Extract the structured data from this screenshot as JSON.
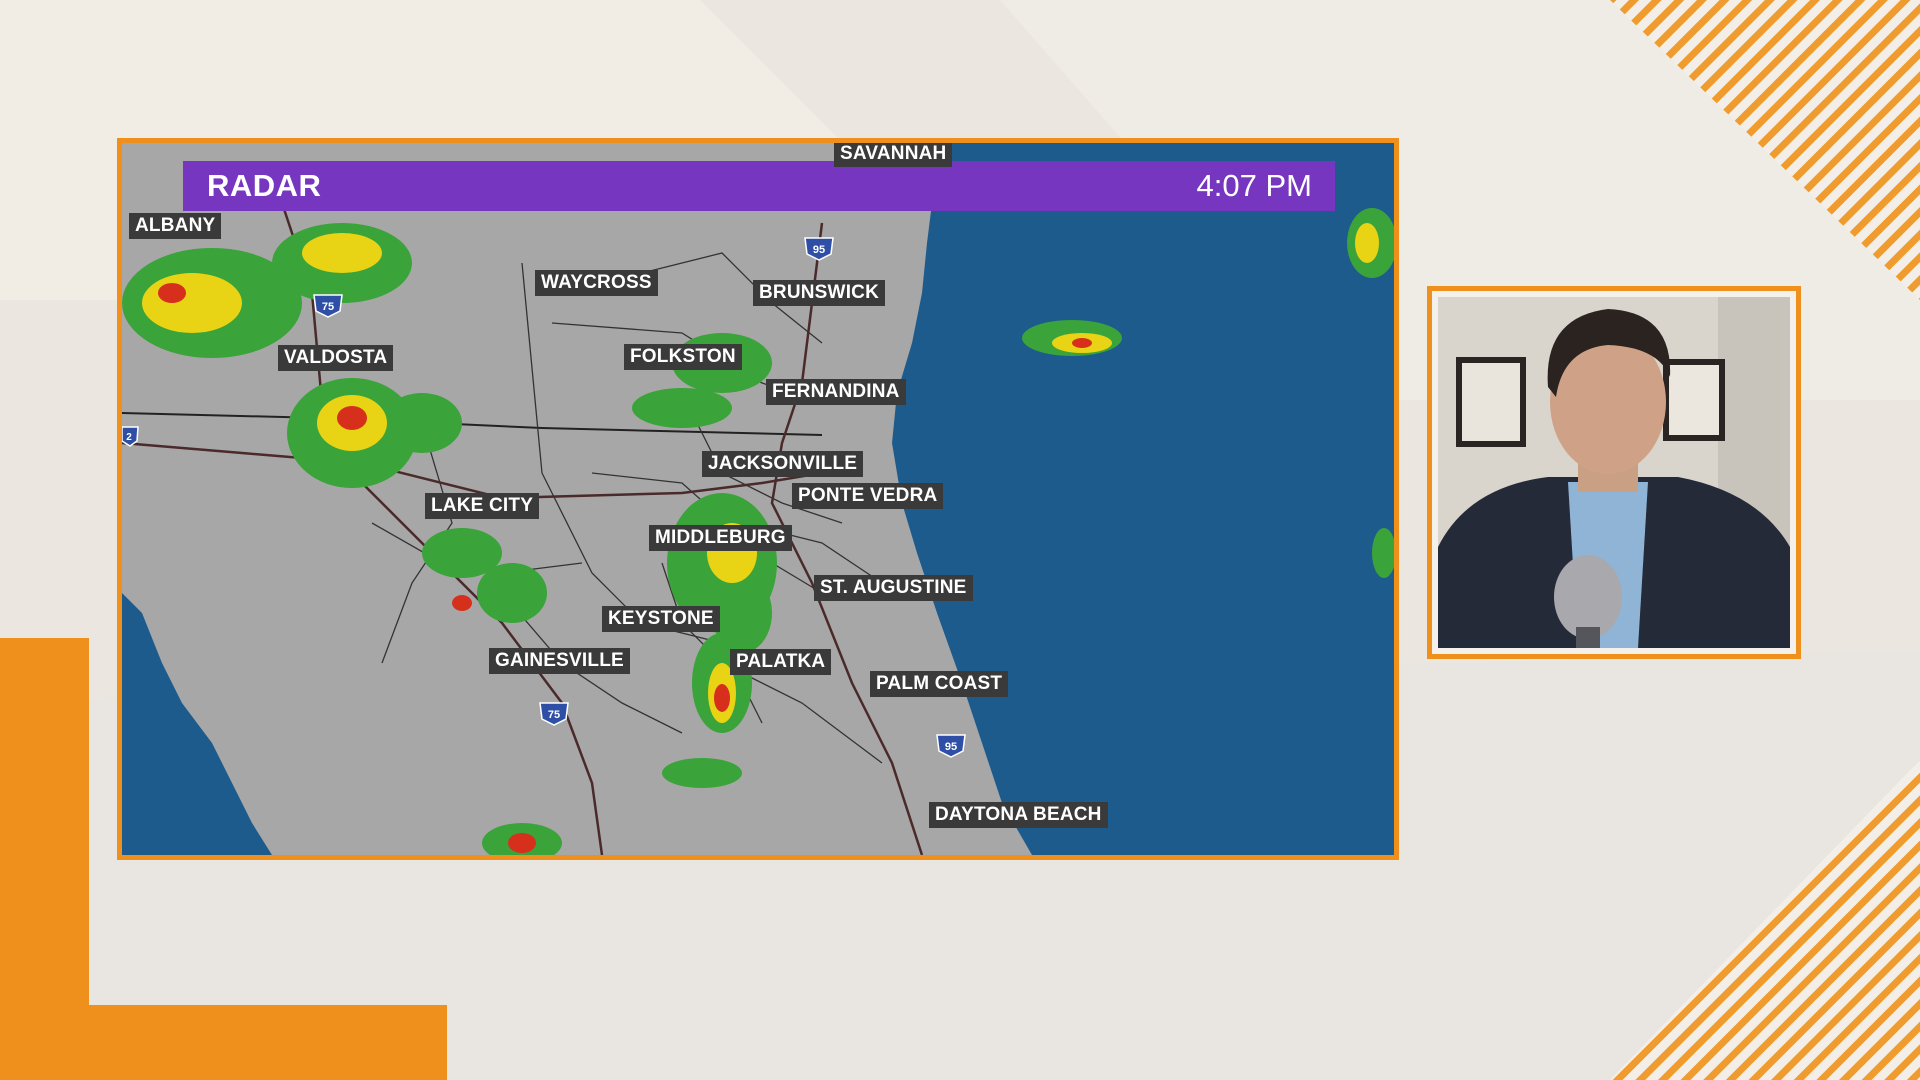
{
  "radar": {
    "title": "RADAR",
    "time": "4:07 PM"
  },
  "cities": {
    "savannah": "SAVANNAH",
    "albany": "ALBANY",
    "waycross": "WAYCROSS",
    "brunswick": "BRUNSWICK",
    "valdosta": "VALDOSTA",
    "folkston": "FOLKSTON",
    "fernandina": "FERNANDINA",
    "jacksonville": "JACKSONVILLE",
    "ponte_vedra": "PONTE VEDRA",
    "lake_city": "LAKE CITY",
    "middleburg": "MIDDLEBURG",
    "st_augustine": "ST. AUGUSTINE",
    "keystone": "KEYSTONE",
    "gainesville": "GAINESVILLE",
    "palatka": "PALATKA",
    "palm_coast": "PALM COAST",
    "daytona_beach": "DAYTONA BEACH"
  },
  "highways": {
    "i75": "75",
    "i95": "95",
    "i10": "2"
  },
  "colors": {
    "accent_orange": "#ef8f1c",
    "title_purple": "#7636c0",
    "ocean": "#1e5c8e",
    "land": "#a9a9a9",
    "label_bg": "#3a3a3a"
  }
}
